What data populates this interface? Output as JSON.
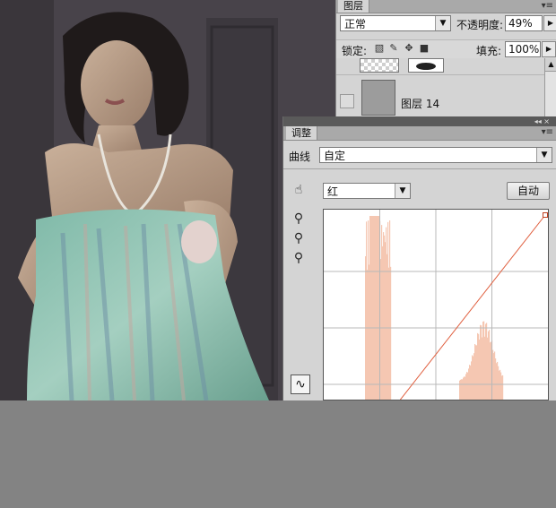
{
  "layers_panel": {
    "tab": "图层",
    "blend_mode": "正常",
    "opacity_label": "不透明度:",
    "opacity_value": "49%",
    "lock_label": "锁定:",
    "fill_label": "填充:",
    "fill_value": "100%",
    "layers": [
      {
        "name": ""
      },
      {
        "name": "图层 14"
      }
    ]
  },
  "adjustments_panel": {
    "tab": "调整",
    "preset_label": "曲线",
    "preset_value": "自定",
    "channel_value": "红",
    "auto_button": "自动"
  },
  "curve": {
    "channel_color": "#e06040",
    "histogram_color": "#f5c7b2",
    "point_start": [
      0.2,
      0.0
    ],
    "point_end": [
      1.0,
      1.0
    ]
  },
  "colors": {
    "panel_bg": "#d4d4d4",
    "panel_dark": "#5a5a5a",
    "canvas_gray": "#838383"
  }
}
